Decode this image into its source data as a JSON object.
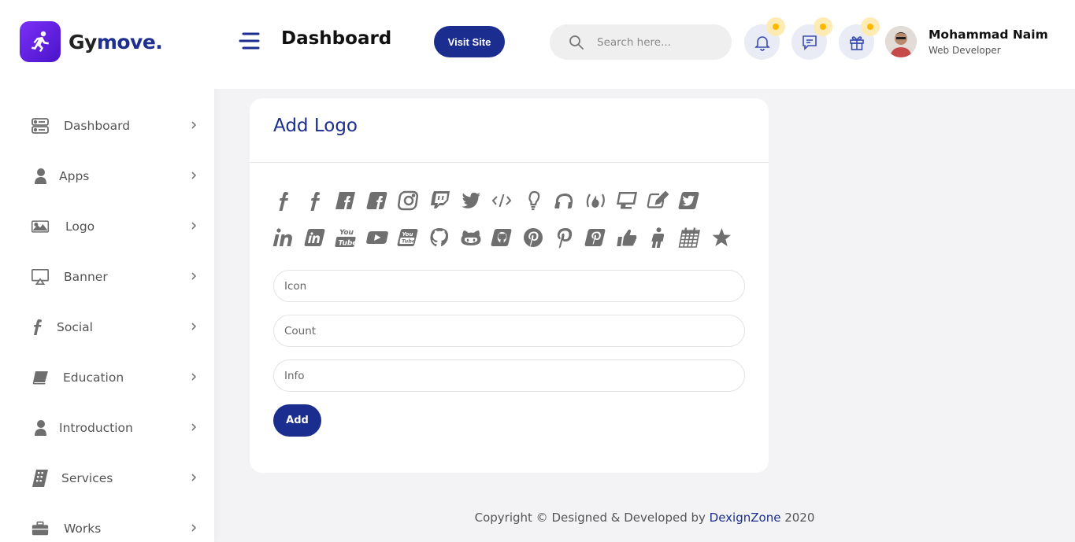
{
  "brand": {
    "name_main": "Gy",
    "name_accent": "move.",
    "icon": "running-person-icon"
  },
  "sidebar": {
    "items": [
      {
        "label": "Dashboard",
        "icon": "dashboard-icon"
      },
      {
        "label": "Apps",
        "icon": "user-icon"
      },
      {
        "label": "Logo",
        "icon": "image-icon"
      },
      {
        "label": "Banner",
        "icon": "monitor-icon"
      },
      {
        "label": "Social",
        "icon": "facebook-f-icon"
      },
      {
        "label": "Education",
        "icon": "book-icon"
      },
      {
        "label": "Introduction",
        "icon": "user-icon"
      },
      {
        "label": "Services",
        "icon": "building-icon"
      },
      {
        "label": "Works",
        "icon": "briefcase-icon"
      }
    ]
  },
  "header": {
    "title": "Dashboard",
    "visit_site": "Visit Site",
    "search_placeholder": "Search here...",
    "user_name": "Mohammad Naim",
    "user_role": "Web Developer"
  },
  "card": {
    "title": "Add Logo",
    "logo_icons_row1": [
      "facebook-f-icon",
      "facebook-f-icon",
      "facebook-square-icon",
      "facebook-square-icon",
      "instagram-icon",
      "twitch-icon",
      "twitter-icon",
      "code-icon",
      "lightbulb-icon",
      "headphones-icon",
      "free-code-camp-icon",
      "desktop-icon",
      "edit-icon",
      "twitter-square-icon"
    ],
    "logo_icons_row2": [
      "linkedin-icon",
      "linkedin-square-icon",
      "youtube-logo-icon",
      "youtube-play-icon",
      "youtube-square-icon",
      "github-icon",
      "github-alt-icon",
      "github-square-icon",
      "pinterest-icon",
      "pinterest-p-icon",
      "pinterest-square-icon",
      "thumbs-up-icon",
      "male-icon",
      "calendar-icon",
      "star-icon"
    ],
    "fields": {
      "icon_placeholder": "Icon",
      "count_placeholder": "Count",
      "info_placeholder": "Info"
    },
    "add_button": "Add"
  },
  "footer": {
    "prefix": "Copyright © Designed & Developed by ",
    "brand": "DexignZone",
    "year": " 2020"
  },
  "colors": {
    "primary": "#1b2d8f",
    "brand_gradient_start": "#7b2ff7",
    "notification_dot": "#ffb800"
  }
}
